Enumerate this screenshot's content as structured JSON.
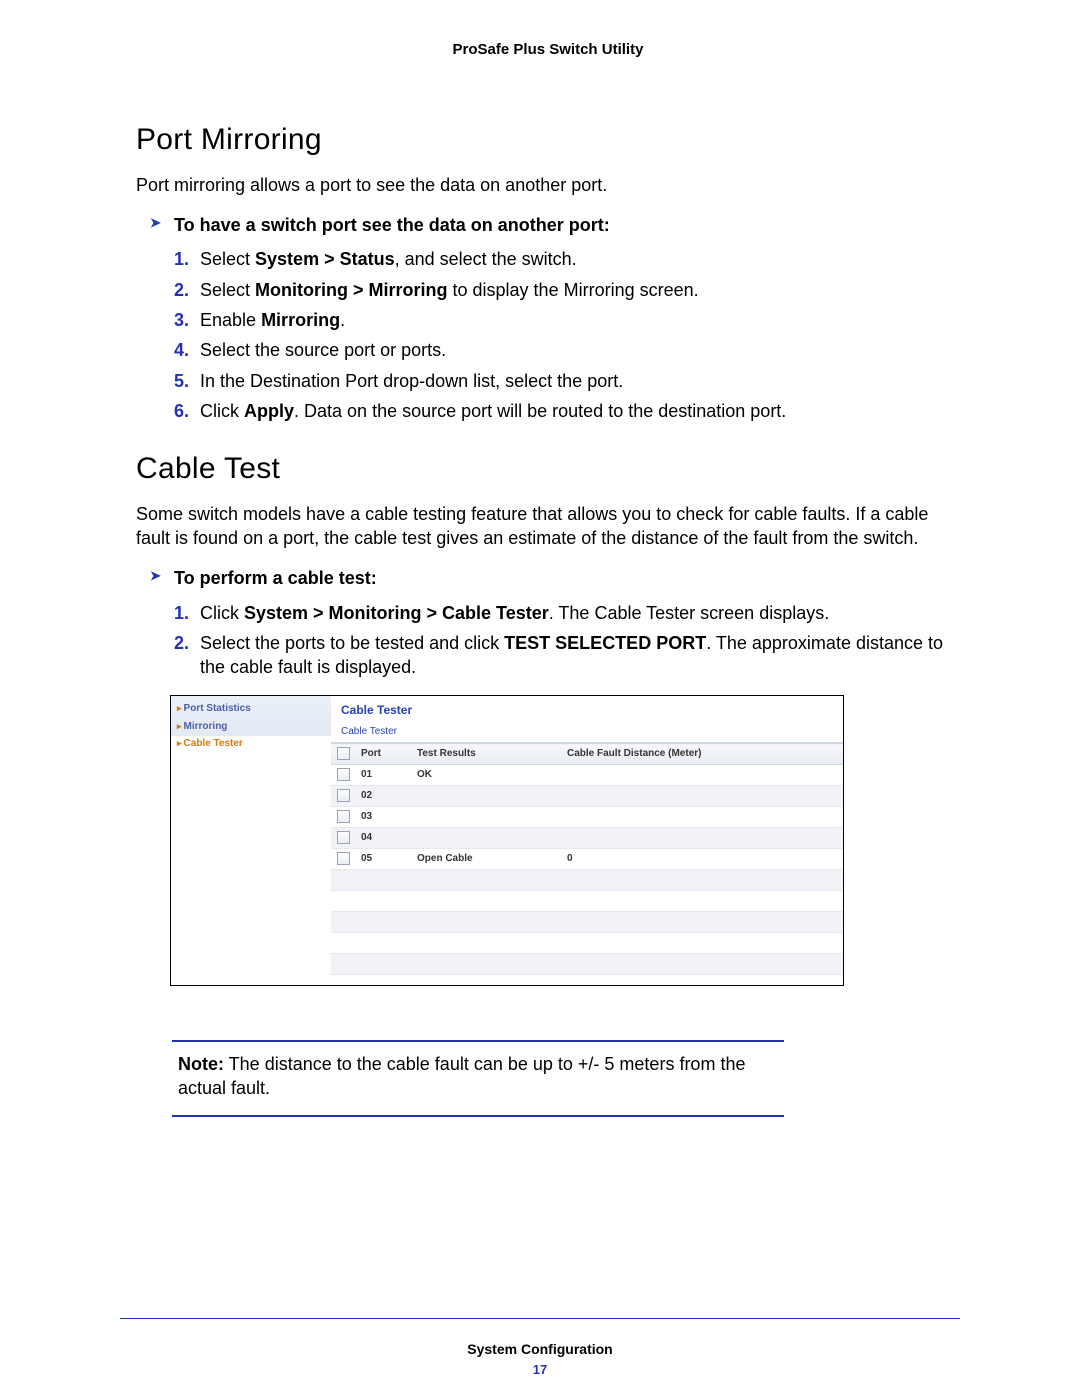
{
  "header": {
    "title": "ProSafe Plus Switch Utility"
  },
  "section1": {
    "heading": "Port Mirroring",
    "intro": "Port mirroring allows a port to see the data on another port.",
    "task": "To have a switch port see the data on another port:",
    "steps": {
      "s1a": "Select ",
      "s1b": "System > Status",
      "s1c": ", and select the switch.",
      "s2a": "Select ",
      "s2b": "Monitoring > Mirroring",
      "s2c": " to display the Mirroring screen.",
      "s3a": "Enable ",
      "s3b": "Mirroring",
      "s3c": ".",
      "s4": "Select the source port or ports.",
      "s5": "In the Destination Port drop-down list, select the port.",
      "s6a": "Click ",
      "s6b": "Apply",
      "s6c": ". Data on the source port will be routed to the destination port."
    }
  },
  "section2": {
    "heading": "Cable Test",
    "intro": "Some switch models have a cable testing feature that allows you to check for cable faults. If a cable fault is found on a port, the cable test gives an estimate of the distance of the fault from the switch.",
    "task": "To perform a cable test:",
    "steps": {
      "s1a": "Click ",
      "s1b": "System > Monitoring > Cable Tester",
      "s1c": ". The Cable Tester screen displays.",
      "s2a": "Select the ports to be tested and click ",
      "s2b": "TEST SELECTED PORT",
      "s2c": ". The approximate distance to the cable fault is displayed."
    }
  },
  "fig": {
    "sidenav": [
      "Port Statistics",
      "Mirroring",
      "Cable Tester"
    ],
    "title": "Cable Tester",
    "subtitle": "Cable Tester",
    "cols": {
      "port": "Port",
      "results": "Test Results",
      "dist": "Cable Fault Distance (Meter)"
    },
    "rows": [
      {
        "port": "01",
        "results": "OK",
        "dist": ""
      },
      {
        "port": "02",
        "results": "",
        "dist": ""
      },
      {
        "port": "03",
        "results": "",
        "dist": ""
      },
      {
        "port": "04",
        "results": "",
        "dist": ""
      },
      {
        "port": "05",
        "results": "Open Cable",
        "dist": "0"
      },
      {
        "port": "",
        "results": "",
        "dist": ""
      },
      {
        "port": "",
        "results": "",
        "dist": ""
      },
      {
        "port": "",
        "results": "",
        "dist": ""
      },
      {
        "port": "",
        "results": "",
        "dist": ""
      },
      {
        "port": "",
        "results": "",
        "dist": ""
      }
    ]
  },
  "note": {
    "label": "Note:",
    "text": "  The distance to the cable fault can be up to +/- 5 meters from the actual fault."
  },
  "footer": {
    "section": "System Configuration",
    "page": "17"
  }
}
